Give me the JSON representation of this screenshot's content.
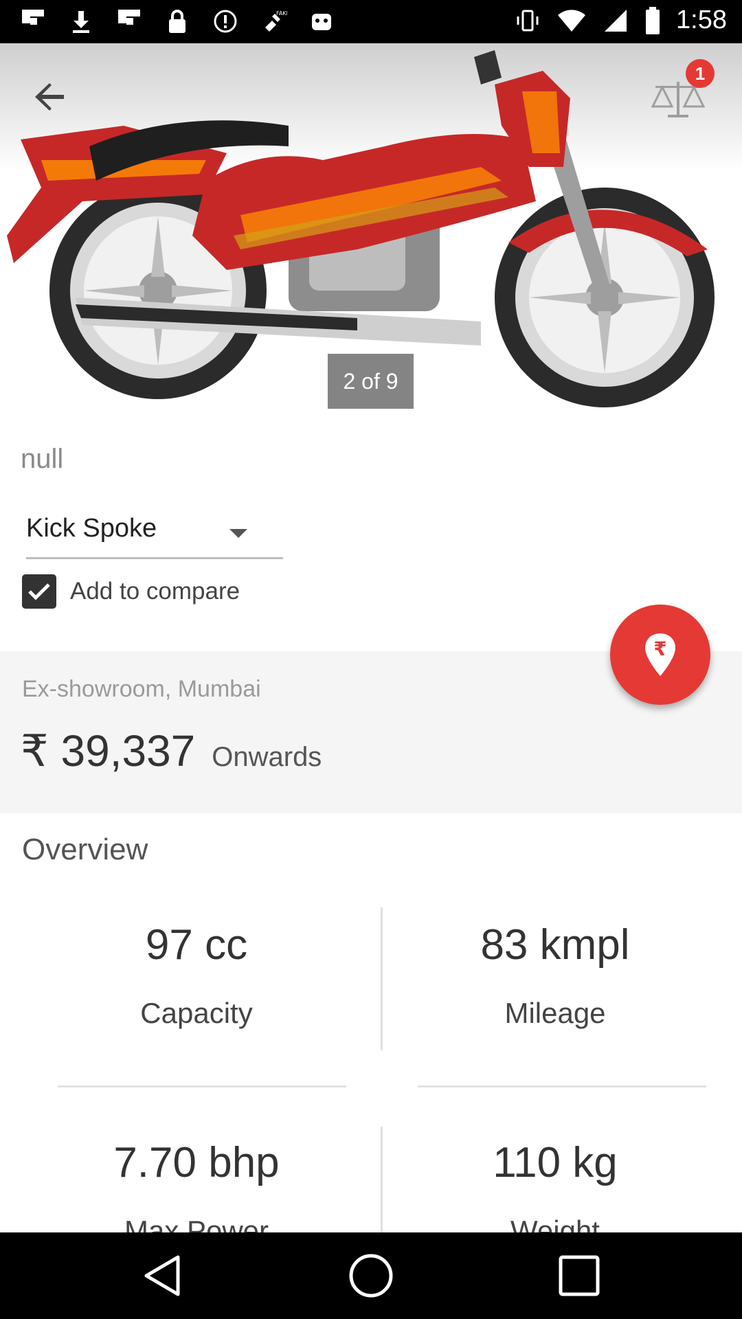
{
  "status_bar": {
    "time": "1:58",
    "icons": [
      "flipboard-icon",
      "download-icon",
      "flipboard-icon",
      "lock-icon",
      "alert-icon",
      "satellite-icon",
      "android-icon",
      "vibrate-icon",
      "wifi-icon",
      "signal-icon",
      "battery-icon"
    ]
  },
  "hero": {
    "page_indicator": "2 of 9",
    "compare_count": "1"
  },
  "product": {
    "model_name": "null",
    "variant": "Kick Spoke",
    "add_to_compare": "Add to compare",
    "add_to_compare_checked": true
  },
  "price": {
    "city": "Ex-showroom, Mumbai",
    "amount": "₹ 39,337",
    "suffix": "Onwards"
  },
  "overview": {
    "title": "Overview",
    "specs": [
      {
        "value": "97 cc",
        "label": "Capacity"
      },
      {
        "value": "83 kmpl",
        "label": "Mileage"
      },
      {
        "value": "7.70 bhp",
        "label": "Max Power"
      },
      {
        "value": "110 kg",
        "label": "Weight"
      }
    ]
  },
  "colors": {
    "accent": "#e53935",
    "bike_red": "#c62828"
  }
}
